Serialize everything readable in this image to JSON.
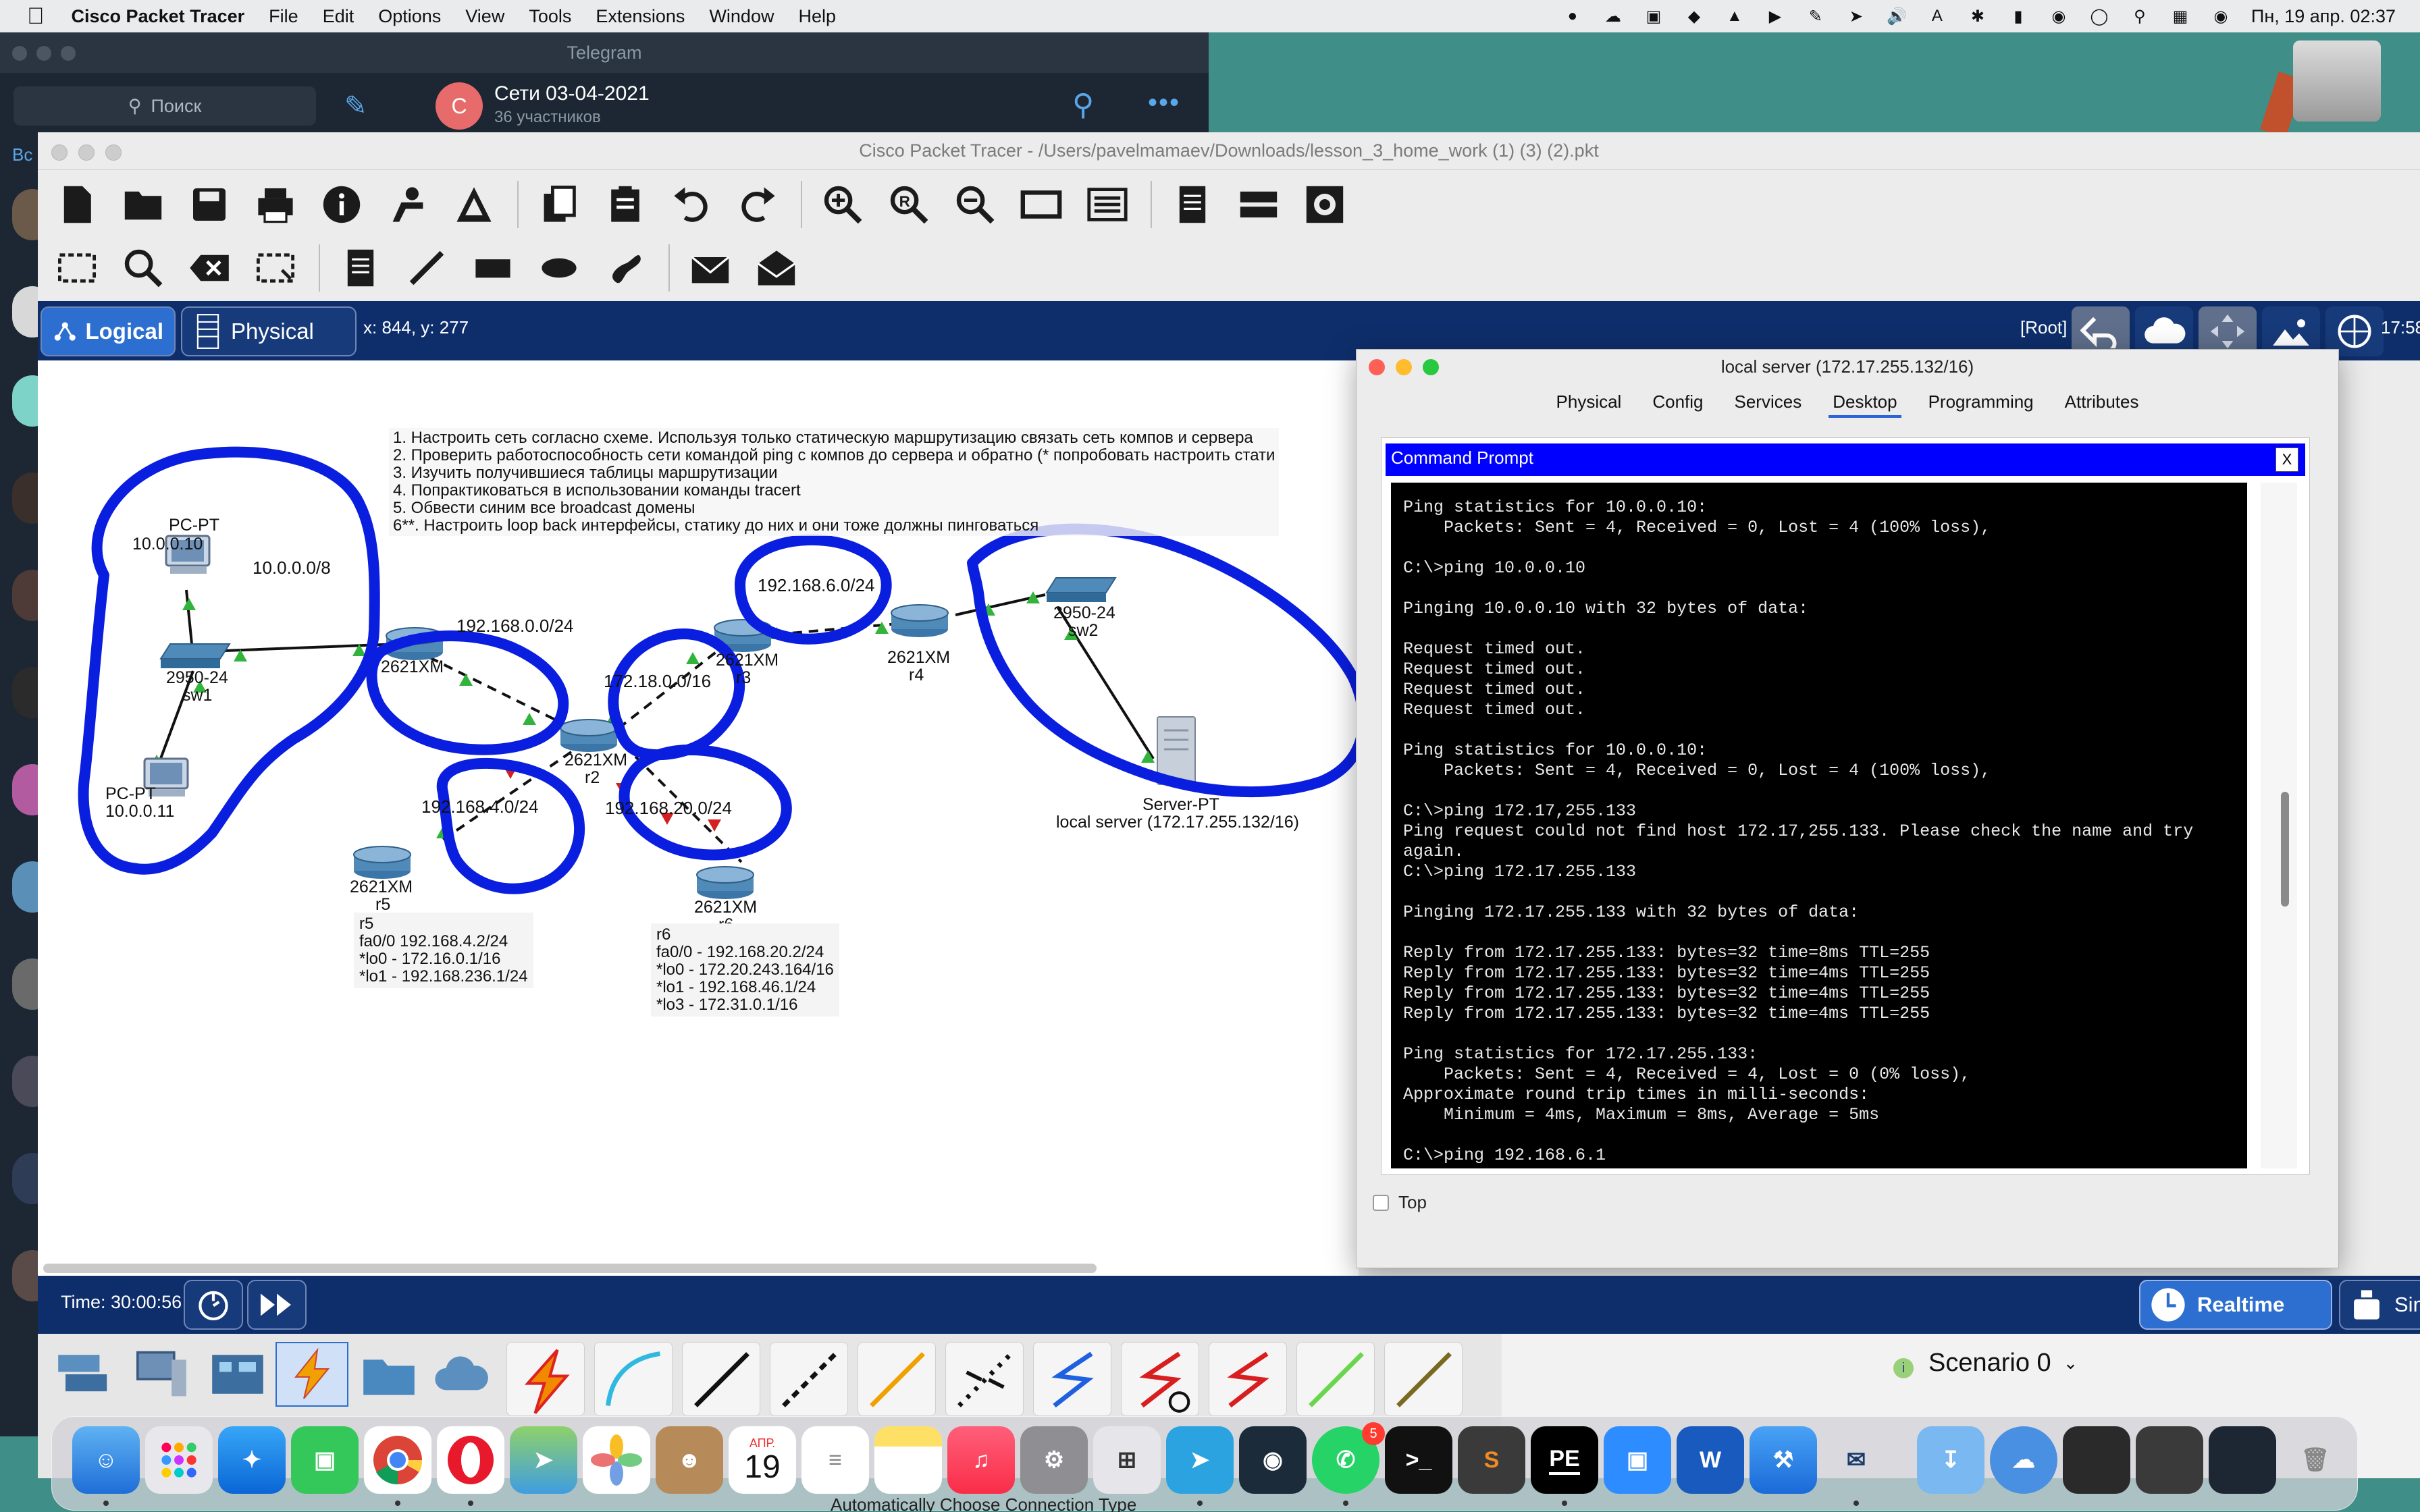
{
  "menubar": {
    "app_name": "Cisco Packet Tracer",
    "items": [
      "File",
      "Edit",
      "Options",
      "View",
      "Tools",
      "Extensions",
      "Window",
      "Help"
    ],
    "clock": "Пн, 19 апр.  02:37"
  },
  "telegram": {
    "window_title": "Telegram",
    "search_placeholder": "Поиск",
    "chat_avatar_letter": "C",
    "chat_title": "Сети 03-04-2021",
    "chat_subtitle": "36 участников",
    "side_tab": "Вс"
  },
  "pt": {
    "window_title": "Cisco Packet Tracer - /Users/pavelmamaev/Downloads/lesson_3_home_work (1) (3) (2).pkt",
    "mode_logical": "Logical",
    "mode_physical": "Physical",
    "coords": "x: 844, y: 277",
    "root": "[Root]",
    "clock_top": "17:58",
    "time": "Time: 30:00:56",
    "realtime": "Realtime",
    "simulation": "Simulat",
    "scenario": "Scenario 0",
    "bottom_hint": "Automatically Choose Connection Type"
  },
  "instructions": [
    "1. Настроить сеть согласно схеме. Используя только статическую маршрутизацию связать сеть компов и сервера",
    "2. Проверить работоспособность сети командой ping с компов до сервера и обратно (* попробовать настроить стати",
    "3. Изучить получившиеся таблицы маршрутизации",
    "4. Попрактиковаться в использовании команды tracert",
    "5. Обвести синим все broadcast домены",
    "6**. Настроить loop back интерфейсы, статику до них и они тоже должны пинговаться"
  ],
  "topology": {
    "pc1_type": "PC-PT",
    "pc1_ip": "10.0.0.10",
    "pc2_type": "PC-PT",
    "pc2_ip": "10.0.0.11",
    "sw1_model": "2950-24",
    "sw1_name": "sw1",
    "sw2_model": "2950-24",
    "sw2_name": "sw2",
    "r1_model": "2621XM",
    "r2_model": "2621XM",
    "r2_name": "r2",
    "r3_model": "2621XM",
    "r3_name": "r3",
    "r4_model": "2621XM",
    "r4_name": "r4",
    "r5_model": "2621XM",
    "r5_name": "r5",
    "r6_model": "2621XM",
    "r6_name": "r6",
    "server_type": "Server-PT",
    "server_name": "local server (172.17.255.132/16)",
    "net_10": "10.0.0.0/8",
    "net_192_168_0": "192.168.0.0/24",
    "net_192_168_6": "192.168.6.0/24",
    "net_172_18": "172.18.0.0/16",
    "net_192_168_4": "192.168.4.0/24",
    "net_192_168_20": "192.168.20.0/24",
    "r5_note": "r5\nfa0/0 192.168.4.2/24\n*lo0 - 172.16.0.1/16\n*lo1 - 192.168.236.1/24",
    "r6_note": "r6\nfa0/0 - 192.168.20.2/24\n*lo0 - 172.20.243.164/16\n*lo1 - 192.168.46.1/24\n*lo3 - 172.31.0.1/16"
  },
  "dialog": {
    "title": "local server (172.17.255.132/16)",
    "tabs": [
      "Physical",
      "Config",
      "Services",
      "Desktop",
      "Programming",
      "Attributes"
    ],
    "active_tab": "Desktop",
    "cmd_title": "Command Prompt",
    "cmd_close": "X",
    "top_checkbox": "Top",
    "output": "Ping statistics for 10.0.0.10:\n    Packets: Sent = 4, Received = 0, Lost = 4 (100% loss),\n\nC:\\>ping 10.0.0.10\n\nPinging 10.0.0.10 with 32 bytes of data:\n\nRequest timed out.\nRequest timed out.\nRequest timed out.\nRequest timed out.\n\nPing statistics for 10.0.0.10:\n    Packets: Sent = 4, Received = 0, Lost = 4 (100% loss),\n\nC:\\>ping 172.17,255.133\nPing request could not find host 172.17,255.133. Please check the name and try\nagain.\nC:\\>ping 172.17.255.133\n\nPinging 172.17.255.133 with 32 bytes of data:\n\nReply from 172.17.255.133: bytes=32 time=8ms TTL=255\nReply from 172.17.255.133: bytes=32 time=4ms TTL=255\nReply from 172.17.255.133: bytes=32 time=4ms TTL=255\nReply from 172.17.255.133: bytes=32 time=4ms TTL=255\n\nPing statistics for 172.17.255.133:\n    Packets: Sent = 4, Received = 4, Lost = 0 (0% loss),\nApproximate round trip times in milli-seconds:\n    Minimum = 4ms, Maximum = 8ms, Average = 5ms\n\nC:\\>ping 192.168.6.1"
  },
  "dock": {
    "calendar_month": "АПР.",
    "calendar_day": "19",
    "whatsapp_badge": "5",
    "pe_label": "PE",
    "word_label": "W"
  },
  "colors": {
    "pt_navy": "#0e2e6b",
    "pt_blue": "#2c6fd0",
    "annotation_blue": "#0a1ee0",
    "cmd_titlebar": "#0000ff"
  }
}
